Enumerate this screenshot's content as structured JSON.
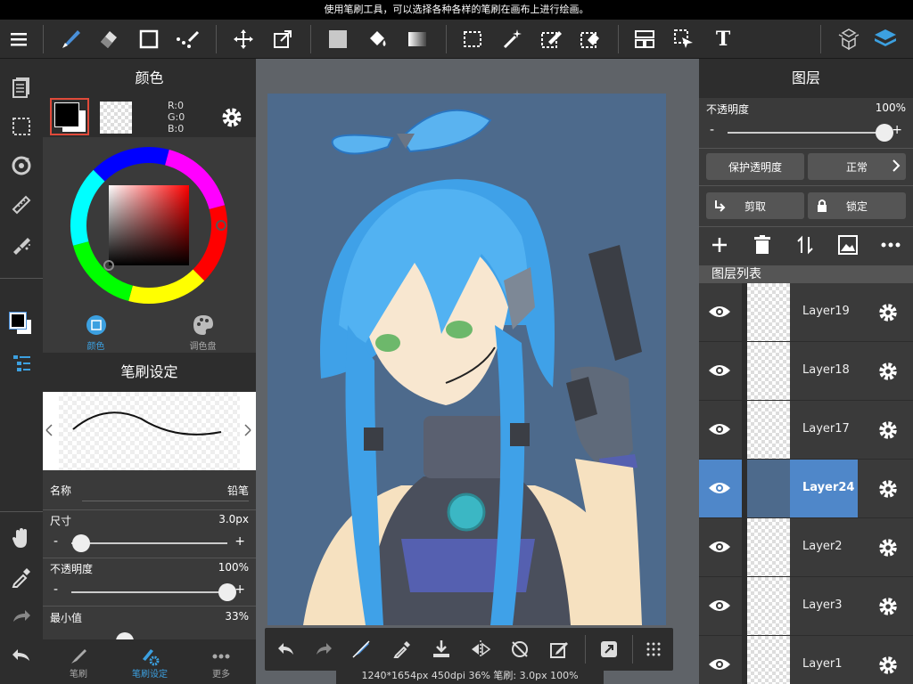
{
  "tip": "使用笔刷工具，可以选择各种各样的笔刷在画布上进行绘画。",
  "colors": {
    "accent": "#4a90d9",
    "toolbar_bg": "#2d2d2d",
    "panel_bg": "#3a3a3a",
    "selected_layer": "#4f87c9",
    "canvas_bg": "#4d6a8c"
  },
  "toolbar": {
    "left_icons": [
      "menu-icon",
      "brush-icon",
      "eraser-icon",
      "rectangle-icon",
      "dot-brush-icon",
      "move-icon",
      "transform-icon",
      "fill-color-icon",
      "bucket-icon",
      "gradient-icon",
      "select-rect-icon",
      "magic-wand-icon",
      "select-pen-icon",
      "select-eraser-icon",
      "divide-icon",
      "select-move-icon",
      "text-icon"
    ],
    "right_icons": [
      "material-icon",
      "layers-icon"
    ],
    "text_tool_label": "T"
  },
  "color_panel": {
    "title": "颜色",
    "rgb": {
      "r": "R:0",
      "g": "G:0",
      "b": "B:0"
    },
    "tabs": [
      {
        "label": "颜色"
      },
      {
        "label": "调色盘"
      }
    ]
  },
  "brush_panel": {
    "title": "笔刷设定",
    "name_label": "名称",
    "name_value": "铅笔",
    "size_label": "尺寸",
    "size_value": "3.0px",
    "size_level": 0.06,
    "opacity_label": "不透明度",
    "opacity_value": "100%",
    "opacity_level": 1.0,
    "min_label": "最小值",
    "min_value": "33%",
    "minus": "-",
    "plus": "+"
  },
  "left_tabs": [
    {
      "label": "笔刷"
    },
    {
      "label": "笔刷设定"
    },
    {
      "label": "更多"
    }
  ],
  "status": "1240*1654px 450dpi 36% 笔刷: 3.0px 100%",
  "layer_panel": {
    "title": "图层",
    "opacity_label": "不透明度",
    "opacity_value": "100%",
    "opacity_level": 1.0,
    "minus": "-",
    "plus": "+",
    "protect_label": "保护透明度",
    "blend_label": "正常",
    "clip_label": "剪取",
    "lock_label": "锁定",
    "list_title": "图层列表",
    "layers": [
      {
        "name": "Layer19",
        "selected": false
      },
      {
        "name": "Layer18",
        "selected": false
      },
      {
        "name": "Layer17",
        "selected": false
      },
      {
        "name": "Layer24",
        "selected": true
      },
      {
        "name": "Layer2",
        "selected": false
      },
      {
        "name": "Layer3",
        "selected": false
      },
      {
        "name": "Layer1",
        "selected": false
      }
    ]
  }
}
